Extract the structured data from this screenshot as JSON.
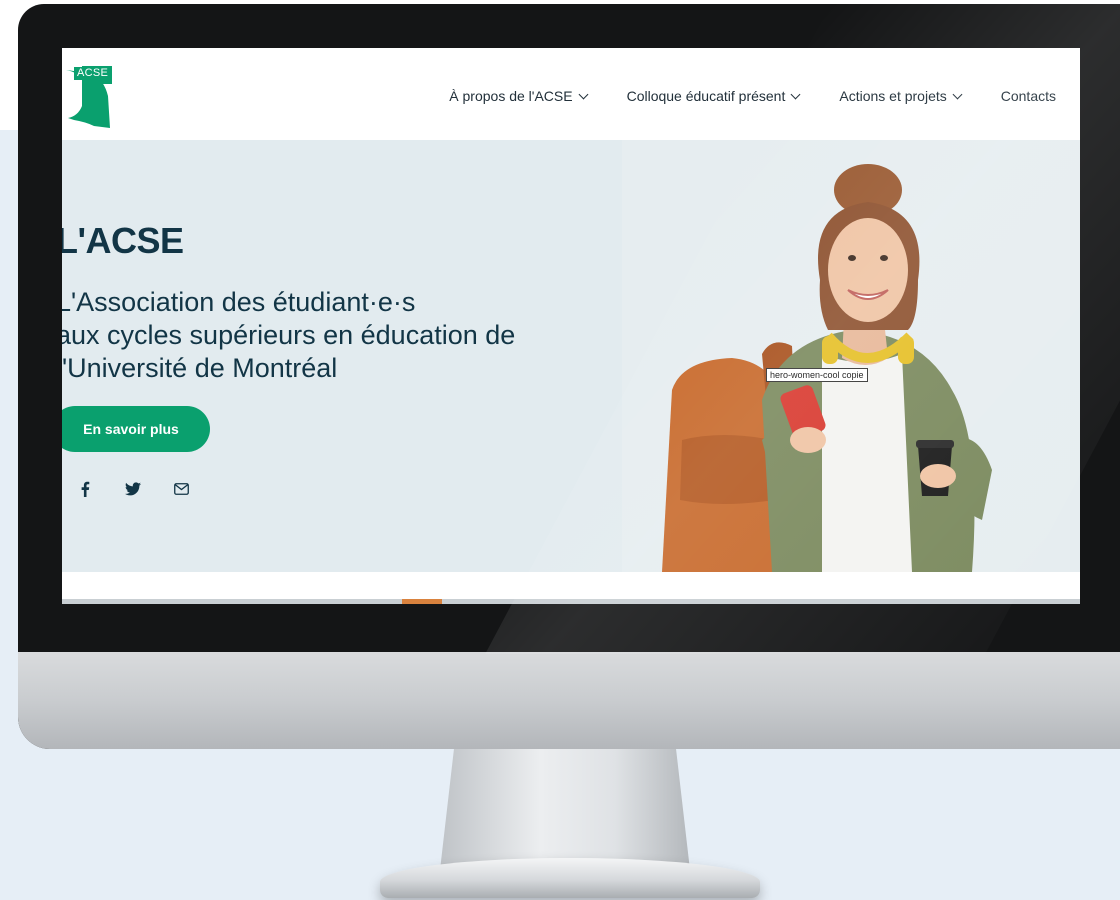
{
  "logo": {
    "text": "ACSE"
  },
  "nav": {
    "items": [
      {
        "label": "À propos de l'ACSE",
        "has_dropdown": true
      },
      {
        "label": "Colloque éducatif présent",
        "has_dropdown": true
      },
      {
        "label": "Actions et projets",
        "has_dropdown": true
      },
      {
        "label": "Contacts",
        "has_dropdown": false
      }
    ]
  },
  "hero": {
    "title": "L'ACSE",
    "subtitle_line1": "L'Association des étudiant·e·s",
    "subtitle_line2": "aux cycles supérieurs en éducation de",
    "subtitle_line3": "l'Université de Montréal",
    "cta_label": "En savoir plus",
    "image_caption": "hero-women-cool copie",
    "socials": [
      {
        "icon": "facebook-icon",
        "glyph": "f"
      },
      {
        "icon": "twitter-icon",
        "glyph": "twitter"
      },
      {
        "icon": "email-icon",
        "glyph": "envelope"
      }
    ]
  },
  "colors": {
    "brand_green": "#0aa06e",
    "hero_bg": "#e2ebef",
    "heading": "#123546"
  }
}
